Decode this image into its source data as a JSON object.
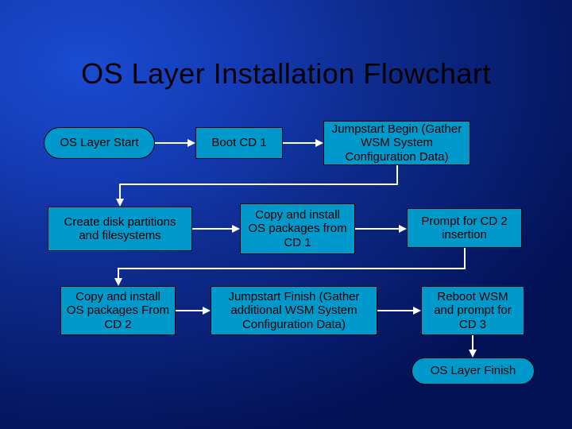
{
  "title": "OS Layer Installation Flowchart",
  "nodes": {
    "start": "OS Layer Start",
    "boot": "Boot CD 1",
    "jsbegin": "Jumpstart Begin (Gather WSM System Configuration Data)",
    "partitions": "Create disk partitions and filesystems",
    "cd1": "Copy and install OS packages from CD 1",
    "prompt2": "Prompt for CD 2 insertion",
    "cd2": "Copy and install OS packages From CD 2",
    "jsfinish": "Jumpstart Finish (Gather additional WSM System Configuration Data)",
    "reboot": "Reboot WSM and prompt for CD 3",
    "finish": "OS Layer Finish"
  }
}
